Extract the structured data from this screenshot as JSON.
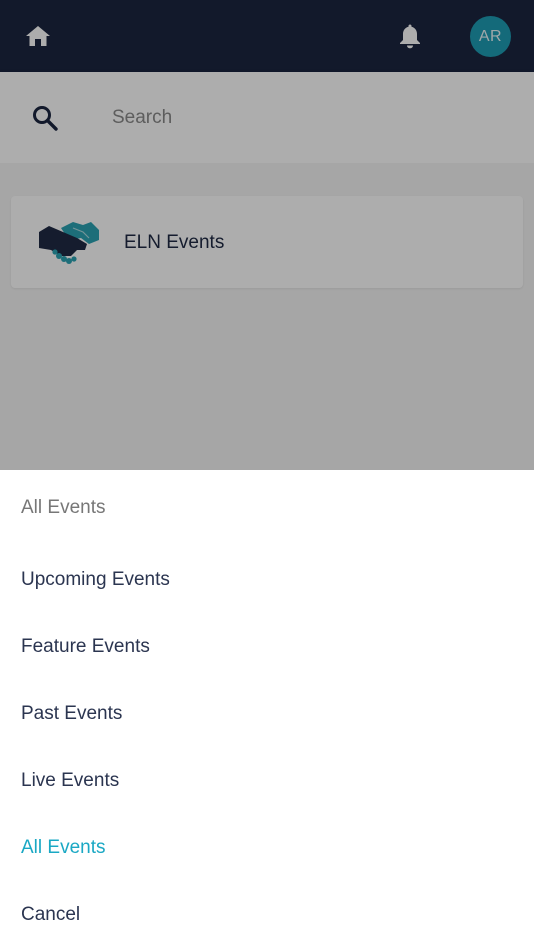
{
  "header": {
    "avatar_initials": "AR",
    "colors": {
      "background": "#1b2540",
      "avatar": "#1e9db4"
    },
    "icons": [
      "home-icon",
      "bell-icon"
    ]
  },
  "search": {
    "placeholder": "Search",
    "value": ""
  },
  "events": [
    {
      "title": "ELN Events",
      "icon": "handshake-icon"
    }
  ],
  "sheet": {
    "title": "All Events",
    "options": [
      {
        "label": "Upcoming Events",
        "selected": false
      },
      {
        "label": "Feature Events",
        "selected": false
      },
      {
        "label": "Past Events",
        "selected": false
      },
      {
        "label": "Live Events",
        "selected": false
      },
      {
        "label": "All Events",
        "selected": true
      },
      {
        "label": "Cancel",
        "selected": false
      }
    ],
    "selected_color": "#1aa8c4"
  }
}
